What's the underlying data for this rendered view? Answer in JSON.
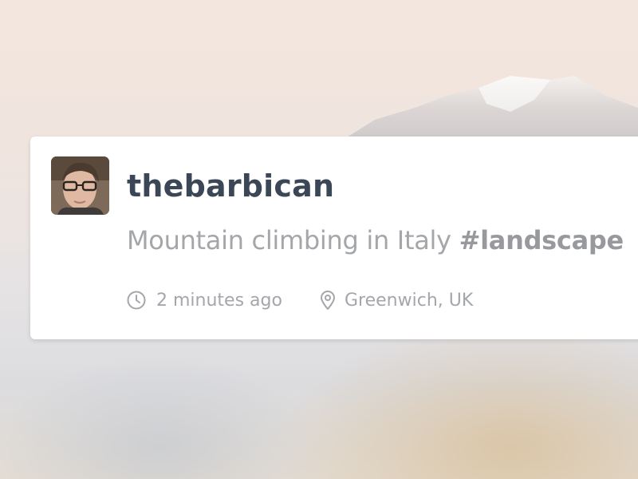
{
  "post": {
    "username": "thebarbican",
    "caption_text": "Mountain climbing in Italy ",
    "hashtag": "#landscape",
    "time_ago": "2 minutes ago",
    "location": "Greenwich, UK"
  },
  "icons": {
    "time": "clock-icon",
    "location": "location-pin-icon"
  },
  "colors": {
    "username": "#3b4656",
    "secondary_text": "#a4a6aa",
    "card_background": "#ffffff"
  }
}
